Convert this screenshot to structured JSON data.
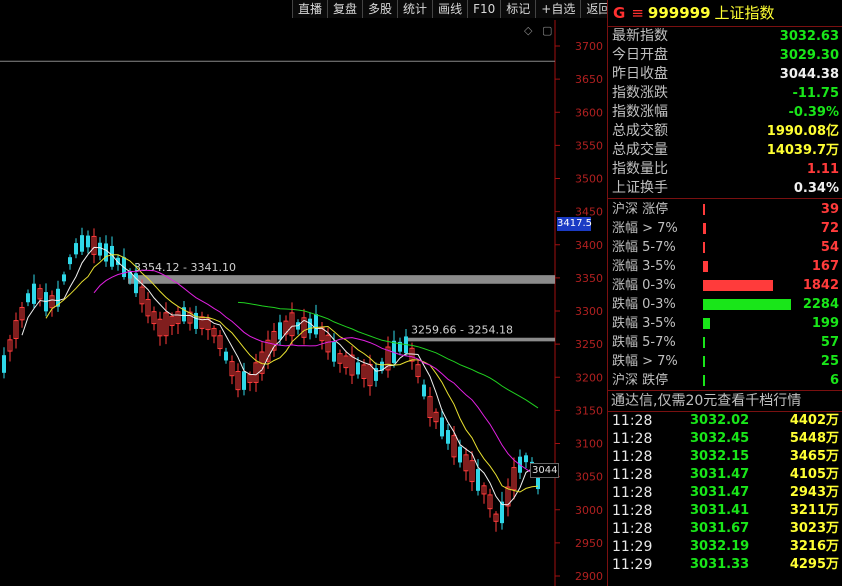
{
  "toolbar": [
    "直播",
    "复盘",
    "多股",
    "统计",
    "画线",
    "F10",
    "标记",
    "+自选",
    "返回"
  ],
  "chart": {
    "y_ticks": [
      "3700",
      "3650",
      "3600",
      "3550",
      "3500",
      "3450",
      "3400",
      "3350",
      "3300",
      "3250",
      "3200",
      "3150",
      "3100",
      "3050",
      "3000",
      "2950",
      "2900"
    ],
    "current_price_tag": "3417.5",
    "last_price_tag": "3044",
    "zone_labels": [
      "3354.12 - 3341.10",
      "3259.66 - 3254.18"
    ],
    "icons": [
      "diamond-icon",
      "square-icon"
    ]
  },
  "chart_data": {
    "type": "candlestick",
    "y_range": [
      2900,
      3700
    ],
    "resistance_zones": [
      {
        "label": "3354.12 - 3341.10",
        "high": 3354.12,
        "low": 3341.1
      },
      {
        "label": "3259.66 - 3254.18",
        "high": 3259.66,
        "low": 3254.18
      }
    ],
    "reference_level": 3677,
    "current_price": 3417.5,
    "last_close": 3044,
    "ma_series": [
      "short",
      "mid",
      "long",
      "longer"
    ]
  },
  "panel": {
    "title": {
      "g": "G",
      "menu": "≡",
      "code": "999999",
      "name": "上证指数"
    },
    "stats": [
      {
        "label": "最新指数",
        "value": "3032.63",
        "color": "green"
      },
      {
        "label": "今日开盘",
        "value": "3029.30",
        "color": "green"
      },
      {
        "label": "昨日收盘",
        "value": "3044.38",
        "color": "white"
      },
      {
        "label": "指数涨跌",
        "value": "-11.75",
        "color": "green"
      },
      {
        "label": "指数涨幅",
        "value": "-0.39%",
        "color": "green"
      },
      {
        "label": "总成交额",
        "value": "1990.08亿",
        "color": "yellow"
      },
      {
        "label": "总成交量",
        "value": "14039.7万",
        "color": "yellow"
      },
      {
        "label": "指数量比",
        "value": "1.11",
        "color": "red"
      },
      {
        "label": "上证换手",
        "value": "0.34%",
        "color": "white"
      }
    ],
    "distribution": [
      {
        "label": "沪深 涨停",
        "value": "39",
        "color": "red",
        "fraction": 0.012
      },
      {
        "label": "涨幅 > 7%",
        "value": "72",
        "color": "red",
        "fraction": 0.03
      },
      {
        "label": "涨幅 5-7%",
        "value": "54",
        "color": "red",
        "fraction": 0.012
      },
      {
        "label": "涨幅 3-5%",
        "value": "167",
        "color": "red",
        "fraction": 0.06
      },
      {
        "label": "涨幅 0-3%",
        "value": "1842",
        "color": "red",
        "fraction": 0.8
      },
      {
        "label": "跌幅 0-3%",
        "value": "2284",
        "color": "green",
        "fraction": 1.0
      },
      {
        "label": "跌幅 3-5%",
        "value": "199",
        "color": "green",
        "fraction": 0.08
      },
      {
        "label": "跌幅 5-7%",
        "value": "57",
        "color": "green",
        "fraction": 0.025
      },
      {
        "label": "跌幅 > 7%",
        "value": "25",
        "color": "green",
        "fraction": 0.012
      },
      {
        "label": "沪深 跌停",
        "value": "6",
        "color": "green",
        "fraction": 0.012
      }
    ],
    "notice": "通达信,仅需20元查看千档行情",
    "ticks": [
      {
        "time": "11:28",
        "price": "3032.02",
        "vol": "4402万",
        "color": "green"
      },
      {
        "time": "11:28",
        "price": "3032.45",
        "vol": "5448万",
        "color": "green"
      },
      {
        "time": "11:28",
        "price": "3032.15",
        "vol": "3465万",
        "color": "green"
      },
      {
        "time": "11:28",
        "price": "3031.47",
        "vol": "4105万",
        "color": "green"
      },
      {
        "time": "11:28",
        "price": "3031.47",
        "vol": "2943万",
        "color": "green"
      },
      {
        "time": "11:28",
        "price": "3031.41",
        "vol": "3211万",
        "color": "green"
      },
      {
        "time": "11:28",
        "price": "3031.67",
        "vol": "3023万",
        "color": "green"
      },
      {
        "time": "11:29",
        "price": "3032.19",
        "vol": "3216万",
        "color": "green"
      },
      {
        "time": "11:29",
        "price": "3031.33",
        "vol": "4295万",
        "color": "green"
      }
    ]
  }
}
